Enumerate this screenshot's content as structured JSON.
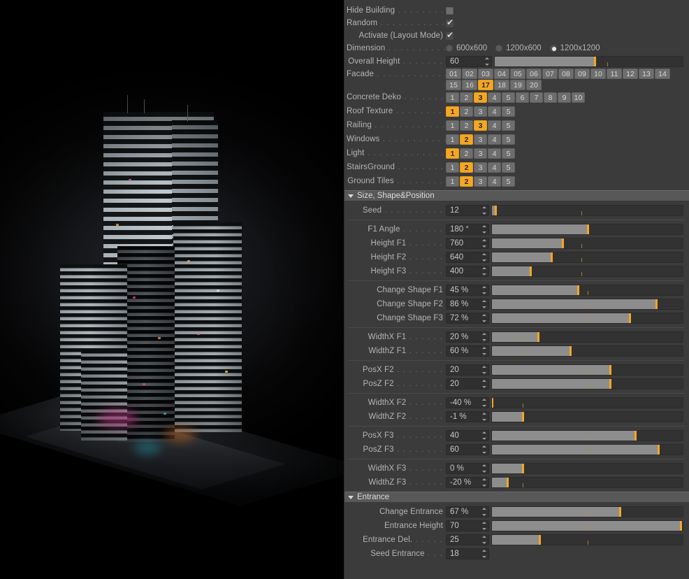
{
  "viewport": {
    "name": "3d-render-viewport",
    "description": "Rendered night-time skyscraper complex on a plaza base, dark background"
  },
  "panel": {
    "top_rows": [
      {
        "label": "Hide Building",
        "dots": ". . . . . . . .",
        "type": "checkbox",
        "checked": false,
        "name": "hide-building"
      },
      {
        "label": "Random",
        "dots": ". . . . . . . . . . .",
        "type": "checkbox",
        "checked": true,
        "name": "random"
      },
      {
        "label": "Activate (Layout Mode)",
        "dots": "",
        "type": "checkbox",
        "checked": true,
        "name": "activate-layout-mode"
      }
    ],
    "dimension": {
      "label": "Dimension",
      "dots": ". . . . . . . . . .",
      "name": "dimension",
      "options": [
        {
          "label": "600x600",
          "selected": false
        },
        {
          "label": "1200x600",
          "selected": false
        },
        {
          "label": "1200x1200",
          "selected": true
        }
      ]
    },
    "overall_height": {
      "label": "Overall Height",
      "dots": ". . . . . . .",
      "value": "60",
      "fill": 53,
      "tick": 60,
      "name": "overall-height"
    },
    "facade": {
      "label": "Facade",
      "dots": ". . . . . . . . . . . .",
      "name": "facade",
      "options": [
        "01",
        "02",
        "03",
        "04",
        "05",
        "06",
        "07",
        "08",
        "09",
        "10",
        "11",
        "12",
        "13",
        "14",
        "15",
        "16",
        "17",
        "18",
        "19",
        "20"
      ],
      "selected": "17"
    },
    "option_rows": [
      {
        "label": "Concrete Deko",
        "dots": ". . . . . . . .",
        "name": "concrete-deko",
        "options": [
          "1",
          "2",
          "3",
          "4",
          "5",
          "6",
          "7",
          "8",
          "9",
          "10"
        ],
        "selected": "3"
      },
      {
        "label": "Roof Texture",
        "dots": ". . . . . . . . .",
        "name": "roof-texture",
        "options": [
          "1",
          "2",
          "3",
          "4",
          "5"
        ],
        "selected": "1"
      },
      {
        "label": "Railing",
        "dots": ". . . . . . . . . . . . .",
        "name": "railing",
        "options": [
          "1",
          "2",
          "3",
          "4",
          "5"
        ],
        "selected": "3"
      },
      {
        "label": "Windows",
        "dots": ". . . . . . . . . . .",
        "name": "windows",
        "options": [
          "1",
          "2",
          "3",
          "4",
          "5"
        ],
        "selected": "2"
      },
      {
        "label": "Light",
        "dots": ". . . . . . . . . . . . . .",
        "name": "light",
        "options": [
          "1",
          "2",
          "3",
          "4",
          "5"
        ],
        "selected": "1"
      },
      {
        "label": "StairsGround",
        "dots": ". . . . . . . .",
        "name": "stairsground",
        "options": [
          "1",
          "2",
          "3",
          "4",
          "5"
        ],
        "selected": "2"
      },
      {
        "label": "Ground Tiles",
        "dots": ". . . . . . . .",
        "name": "ground-tiles",
        "options": [
          "1",
          "2",
          "3",
          "4",
          "5"
        ],
        "selected": "2"
      }
    ],
    "groups": [
      {
        "title": "Size, Shape&Position",
        "name": "group-size-shape-position",
        "expanded": true,
        "blocks": [
          [
            {
              "label": "Seed",
              "dots": ". . . . . . . . . .",
              "value": "12",
              "fill": 2,
              "tick": 47,
              "name": "seed"
            }
          ],
          [
            {
              "label": "F1 Angle",
              "dots": ". . . . . . .",
              "value": "180 °",
              "fill": 50,
              "tick": 50,
              "name": "f1-angle"
            },
            {
              "label": "Height F1",
              "dots": ". . . . . .",
              "value": "760",
              "fill": 37,
              "tick": 47,
              "name": "height-f1"
            },
            {
              "label": "Height F2",
              "dots": ". . . . . .",
              "value": "640",
              "fill": 31,
              "tick": 47,
              "name": "height-f2"
            },
            {
              "label": "Height F3",
              "dots": ". . . . . .",
              "value": "400",
              "fill": 20,
              "tick": 47,
              "name": "height-f3"
            }
          ],
          [
            {
              "label": "Change Shape F1",
              "dots": "",
              "value": "45 %",
              "fill": 45,
              "tick": 50,
              "name": "change-shape-f1"
            },
            {
              "label": "Change Shape F2",
              "dots": "",
              "value": "86 %",
              "fill": 86,
              "tick": 50,
              "name": "change-shape-f2"
            },
            {
              "label": "Change Shape F3",
              "dots": "",
              "value": "72 %",
              "fill": 72,
              "tick": 50,
              "name": "change-shape-f3"
            }
          ],
          [
            {
              "label": "WidthX F1",
              "dots": ". . . . . .",
              "value": "20 %",
              "fill": 24,
              "tick": 16,
              "name": "widthx-f1"
            },
            {
              "label": "WidthZ F1",
              "dots": ". . . . . .",
              "value": "60 %",
              "fill": 41,
              "tick": 16,
              "name": "widthz-f1"
            }
          ],
          [
            {
              "label": "PosX F2",
              "dots": ". . . . . . . .",
              "value": "20",
              "fill": 62,
              "tick": 50,
              "name": "posx-f2"
            },
            {
              "label": "PosZ F2",
              "dots": ". . . . . . . .",
              "value": "20",
              "fill": 62,
              "tick": 50,
              "name": "posz-f2"
            }
          ],
          [
            {
              "label": "WidthX F2",
              "dots": ". . . . . .",
              "value": "-40 %",
              "fill": 0,
              "tick": 16,
              "name": "widthx-f2"
            },
            {
              "label": "WidthZ F2",
              "dots": ". . . . . .",
              "value": "-1 %",
              "fill": 16,
              "tick": 16,
              "name": "widthz-f2"
            }
          ],
          [
            {
              "label": "PosX F3",
              "dots": ". . . . . . . .",
              "value": "40",
              "fill": 75,
              "tick": 50,
              "name": "posx-f3"
            },
            {
              "label": "PosZ F3",
              "dots": ". . . . . . . .",
              "value": "60",
              "fill": 87,
              "tick": 50,
              "name": "posz-f3"
            }
          ],
          [
            {
              "label": "WidthX F3",
              "dots": ". . . . . .",
              "value": "0 %",
              "fill": 16,
              "tick": 16,
              "name": "widthx-f3"
            },
            {
              "label": "WidthZ F3",
              "dots": ". . . . . .",
              "value": "-20 %",
              "fill": 8,
              "tick": 16,
              "name": "widthz-f3"
            }
          ]
        ]
      },
      {
        "title": "Entrance",
        "name": "group-entrance",
        "expanded": true,
        "blocks": [
          [
            {
              "label": "Change Entrance",
              "dots": "",
              "value": "67 %",
              "fill": 67,
              "tick": 50,
              "name": "change-entrance"
            },
            {
              "label": "Entrance Height",
              "dots": "",
              "value": "70",
              "fill": 99,
              "tick": 50,
              "name": "entrance-height"
            },
            {
              "label": "Entrance Del.",
              "dots": ". . . . .",
              "value": "25",
              "fill": 25,
              "tick": 50,
              "name": "entrance-del"
            },
            {
              "label": "Seed Entrance",
              "dots": ". . .",
              "value": "18",
              "noslider": true,
              "name": "seed-entrance"
            }
          ]
        ]
      }
    ]
  },
  "colors": {
    "panel_bg": "#3b3b3b",
    "accent_orange": "#f5a623",
    "slider_fill": "#8d8d8d",
    "slider_track": "#323232",
    "button_bg": "#6e6e6e",
    "group_header": "#585858",
    "text": "#b5b5b5"
  }
}
